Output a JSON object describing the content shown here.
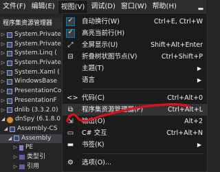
{
  "menubar": {
    "items": [
      {
        "label": "文件(F)"
      },
      {
        "label": "编辑(E)"
      },
      {
        "label": "视图(V)"
      },
      {
        "label": "调试(D)"
      },
      {
        "label": "窗口(W)"
      },
      {
        "label": "帮助(H)"
      }
    ]
  },
  "explorer": {
    "title": "程序集资源管理器",
    "rows": [
      {
        "label": "System.Private.",
        "icon": "assembly-icon"
      },
      {
        "label": "System.Private.",
        "icon": "assembly-icon"
      },
      {
        "label": "System.Linq (",
        "icon": "assembly-icon"
      },
      {
        "label": "System.Private.",
        "icon": "assembly-icon"
      },
      {
        "label": "System.Xaml (",
        "icon": "assembly-icon"
      },
      {
        "label": "WindowsBase",
        "icon": "assembly-icon"
      },
      {
        "label": "PresentationCo",
        "icon": "assembly-icon"
      },
      {
        "label": "PresentationF",
        "icon": "assembly-icon"
      },
      {
        "label": "dnlib (3.3.2.0)",
        "icon": "assembly-icon"
      },
      {
        "label": "dnSpy (6.1.8.0",
        "icon": "dnspy-icon"
      },
      {
        "label": "Assembly-CS",
        "icon": "assembly-icon"
      },
      {
        "label": "Assembly",
        "icon": "assembly-icon"
      },
      {
        "label": "PE",
        "icon": "pe-icon"
      },
      {
        "label": "类型引",
        "icon": "folder-icon"
      },
      {
        "label": "引用",
        "icon": "folder-icon"
      }
    ]
  },
  "view_menu": {
    "items": [
      {
        "type": "item",
        "label": "自动换行(W)",
        "shortcut": "Ctrl+E, Ctrl+W",
        "icon": "check-icon",
        "checked": true
      },
      {
        "type": "item",
        "label": "高亮当前行(H)",
        "shortcut": "",
        "icon": "check-icon",
        "checked": true
      },
      {
        "type": "item",
        "label": "全屏显示(U)",
        "shortcut": "Shift+Alt+Enter",
        "icon": "fullscreen-icon"
      },
      {
        "type": "item",
        "label": "折叠树状图节点(V)",
        "shortcut": "Ctrl+Shift+P",
        "icon": "collapse-icon"
      },
      {
        "type": "item",
        "label": "主题(T)",
        "shortcut": "",
        "icon": "",
        "submenu": true
      },
      {
        "type": "item",
        "label": "语言",
        "shortcut": "",
        "icon": "",
        "submenu": true
      },
      {
        "type": "separator"
      },
      {
        "type": "item",
        "label": "代码(C)",
        "shortcut": "Ctrl+Alt+0",
        "icon": "code-icon"
      },
      {
        "type": "item",
        "label": "程序集资源管理器(P)",
        "shortcut": "Ctrl+Alt+L",
        "icon": "assembly-explorer-icon",
        "hover": true
      },
      {
        "type": "item",
        "label": "输出(O)",
        "shortcut": "Alt+2",
        "icon": "output-icon"
      },
      {
        "type": "item",
        "label": "C# 交互",
        "shortcut": "Ctrl+Alt+N",
        "icon": "csharp-icon"
      },
      {
        "type": "item",
        "label": "书签(K)",
        "shortcut": "",
        "icon": "bookmark-icon",
        "submenu": true
      },
      {
        "type": "separator"
      },
      {
        "type": "item",
        "label": "选项(O)...",
        "shortcut": "",
        "icon": "gear-icon"
      }
    ]
  },
  "colors": {
    "background": "#252526",
    "menu_background": "#1b1b1c",
    "annotation": "#e0101a"
  }
}
